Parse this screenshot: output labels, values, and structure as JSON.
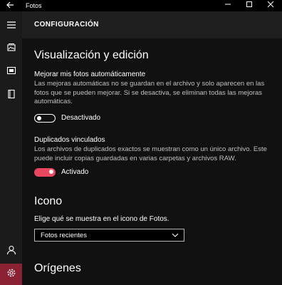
{
  "window": {
    "title": "Fotos",
    "back_icon": "back-arrow-icon",
    "minimize_glyph": "—",
    "maximize_glyph": "☐",
    "close_glyph": "✕"
  },
  "sidebar": {
    "items": [
      {
        "icon": "hamburger-menu-icon"
      },
      {
        "icon": "collection-icon"
      },
      {
        "icon": "album-icon"
      },
      {
        "icon": "folder-icon"
      },
      {
        "icon": "account-icon"
      },
      {
        "icon": "gear-icon",
        "selected": true
      }
    ],
    "settings_color": "#8a2233"
  },
  "header": {
    "title": "CONFIGURACIÓN"
  },
  "sections": {
    "viewing": {
      "title": "Visualización y edición",
      "enhance": {
        "title": "Mejorar mis fotos automáticamente",
        "description": "Las mejoras automáticas no se guardan en el archivo y solo aparecen en las fotos que se pueden mejorar. Si se desactiva, se eliminan todas las mejoras automáticas.",
        "state": "Desactivado",
        "on": false
      },
      "duplicates": {
        "title": "Duplicados vinculados",
        "description": "Los archivos de duplicados exactos se muestran como un único archivo. Este puede incluir copias guardadas en varias carpetas y archivos RAW.",
        "state": "Activado",
        "on": true
      }
    },
    "tile": {
      "title": "Icono",
      "label": "Elige qué se muestra en el icono de Fotos.",
      "selected": "Fotos recientes"
    },
    "sources": {
      "title": "Orígenes"
    }
  },
  "colors": {
    "accent": "#e8475f",
    "background": "#111111",
    "header": "#1f1f1f"
  }
}
